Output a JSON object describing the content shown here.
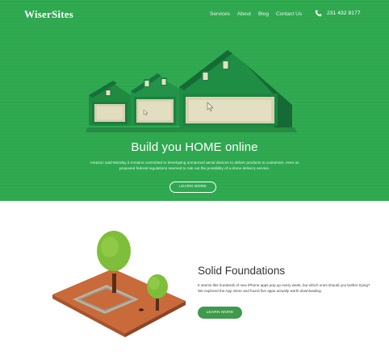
{
  "nav": {
    "logo": "WiserSites",
    "links": [
      "Services",
      "About",
      "Blog",
      "Contact Us"
    ],
    "phone": "231 432 8177"
  },
  "hero": {
    "title": "Build you HOME online",
    "description": "Amazon said Monday it remains committed to developing unmanned aerial devices to deliver products to customers, even as proposed federal regulations seemed to rule out the possibility of a drone delivery service.",
    "button": "LEARN MORE"
  },
  "feature": {
    "title": "Solid Foundations",
    "description": "It seems like hundreds of new iPhone apps pop up every week, but which ones should you bother trying? We explored the App Store and found five apps actually worth downloading.",
    "button": "LEARN MORE"
  },
  "colors": {
    "hero_green": "#2ea84f",
    "button_green": "#3f9a4c"
  },
  "icons": [
    "phone-icon",
    "cursor-icon"
  ]
}
